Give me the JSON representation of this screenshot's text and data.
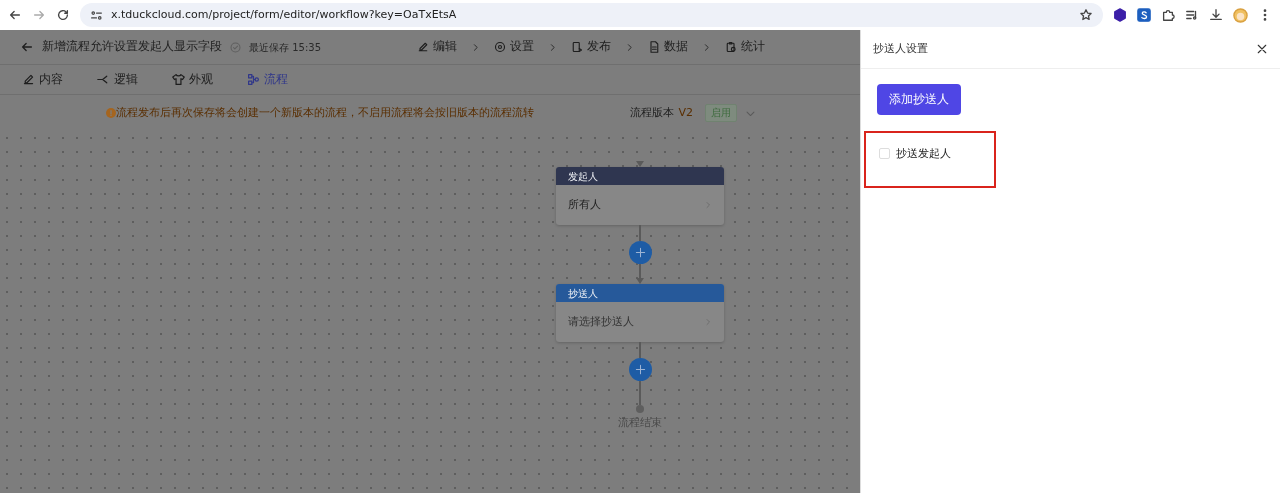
{
  "browser": {
    "url": "x.tduckcloud.com/project/form/editor/workflow?key=OaTxEtsA"
  },
  "app": {
    "title": "新增流程允许设置发起人显示字段",
    "save_status": "最近保存 15:35",
    "steps": [
      {
        "label": "编辑",
        "kind": "edit"
      },
      {
        "label": "设置",
        "kind": "settings"
      },
      {
        "label": "发布",
        "kind": "publish"
      },
      {
        "label": "数据",
        "kind": "data"
      },
      {
        "label": "统计",
        "kind": "stats"
      }
    ],
    "tabs": [
      {
        "label": "内容",
        "kind": "content",
        "selected": false
      },
      {
        "label": "逻辑",
        "kind": "logic",
        "selected": false
      },
      {
        "label": "外观",
        "kind": "look",
        "selected": false
      },
      {
        "label": "流程",
        "kind": "flow",
        "selected": true
      }
    ],
    "notice": "流程发布后再次保存将会创建一个新版本的流程，不启用流程将会按旧版本的流程流转",
    "version_label": "流程版本",
    "version": "V2",
    "status_tag": "启用"
  },
  "flow": {
    "nodes": [
      {
        "kind": "starter",
        "header": "发起人",
        "value": "所有人"
      },
      {
        "kind": "cc",
        "header": "抄送人",
        "placeholder": "请选择抄送人"
      }
    ],
    "end_label": "流程结束"
  },
  "drawer": {
    "title": "抄送人设置",
    "add_button": "添加抄送人",
    "options": [
      {
        "label": "抄送发起人",
        "checked": false,
        "highlighted": true
      }
    ]
  }
}
